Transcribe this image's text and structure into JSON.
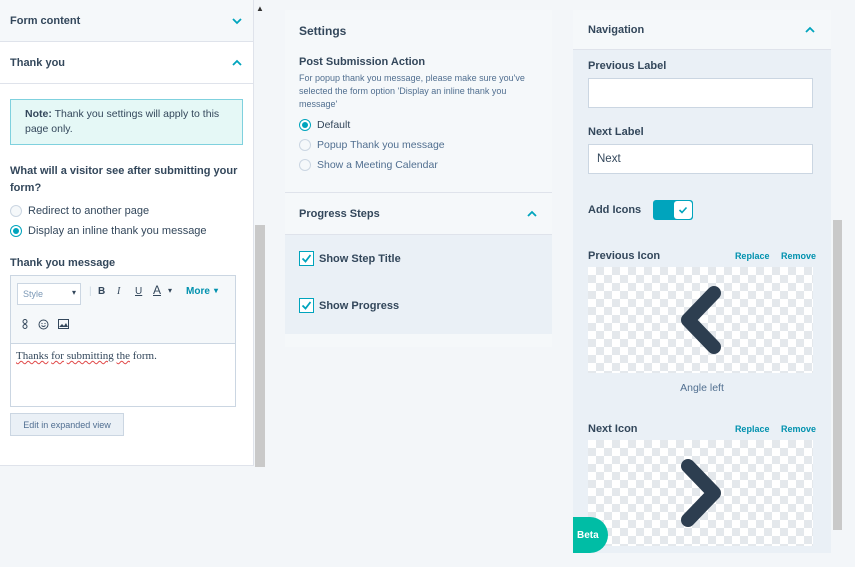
{
  "left": {
    "form_content_label": "Form content",
    "thank_you_label": "Thank you",
    "note_bold": "Note:",
    "note_text": " Thank you settings will apply to this page only.",
    "question": "What will a visitor see after submitting your form?",
    "options": [
      "Redirect to another page",
      "Display an inline thank you message"
    ],
    "selected_option": "Display an inline thank you message",
    "message_label": "Thank you message",
    "toolbar": {
      "style_placeholder": "Style",
      "bold": "B",
      "italic": "I",
      "underline": "U",
      "font_color": "A",
      "more": "More"
    },
    "message_words": [
      "Thanks",
      "for",
      "submitting",
      "the",
      "form."
    ],
    "expand_button": "Edit in expanded view"
  },
  "middle": {
    "settings_title": "Settings",
    "psa_title": "Post Submission Action",
    "psa_desc": "For popup thank you message, please make sure you've selected the form option 'Display an inline thank you message'",
    "options": [
      "Default",
      "Popup Thank you message",
      "Show a Meeting Calendar"
    ],
    "selected_option": "Default",
    "progress_steps_label": "Progress Steps",
    "checkboxes": [
      {
        "label": "Show Step Title",
        "checked": true
      },
      {
        "label": "Show Progress",
        "checked": true
      }
    ]
  },
  "right": {
    "navigation_label": "Navigation",
    "previous_label_title": "Previous Label",
    "previous_label_value": "",
    "next_label_title": "Next Label",
    "next_label_value": "Next",
    "add_icons_label": "Add Icons",
    "add_icons_on": true,
    "previous_icon_title": "Previous Icon",
    "next_icon_title": "Next Icon",
    "replace_label": "Replace",
    "remove_label": "Remove",
    "previous_icon_caption": "Angle left",
    "previous_icon_name": "angle-left-icon",
    "next_icon_name": "angle-right-icon"
  },
  "beta_label": "Beta",
  "colors": {
    "accent": "#00a4bd",
    "link": "#0091ae",
    "beta": "#00bda5",
    "icon": "#2d3e50"
  }
}
